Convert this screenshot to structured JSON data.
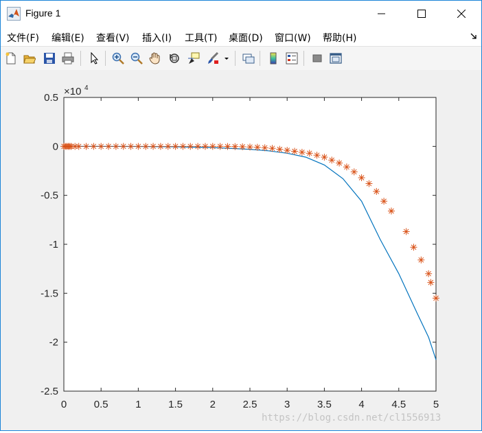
{
  "window": {
    "title": "Figure 1",
    "icon": "matlab-icon",
    "controls": [
      "minimize-icon",
      "maximize-icon",
      "close-icon"
    ]
  },
  "menu": {
    "items": [
      "文件(F)",
      "编辑(E)",
      "查看(V)",
      "插入(I)",
      "工具(T)",
      "桌面(D)",
      "窗口(W)",
      "帮助(H)"
    ],
    "overflow_icon": "dock-arrow-icon"
  },
  "toolbar": {
    "buttons": [
      "new-figure-icon",
      "open-file-icon",
      "save-icon",
      "print-icon",
      "edit-plot-icon",
      "zoom-in-icon",
      "zoom-out-icon",
      "pan-icon",
      "rotate-3d-icon",
      "data-cursor-icon",
      "brush-icon",
      "link-plot-icon",
      "insert-colorbar-icon",
      "insert-legend-icon",
      "hide-plot-tools-icon",
      "show-plot-tools-icon"
    ]
  },
  "watermark": "https://blog.csdn.net/cl1556913",
  "chart_data": {
    "type": "line",
    "exponent_label": "×10",
    "exponent_power": "4",
    "xlim": [
      0,
      5
    ],
    "ylim": [
      -2.5,
      0.5
    ],
    "xticks": [
      "0",
      "0.5",
      "1",
      "1.5",
      "2",
      "2.5",
      "3",
      "3.5",
      "4",
      "4.5",
      "5"
    ],
    "yticks": [
      "0.5",
      "0",
      "-0.5",
      "-1",
      "-1.5",
      "-2",
      "-2.5"
    ],
    "line_color": "#0072bd",
    "marker_color": "#d95319",
    "series": [
      {
        "style": "line",
        "x": [
          0,
          0.5,
          1,
          1.5,
          2,
          2.5,
          2.75,
          3,
          3.25,
          3.5,
          3.75,
          4,
          4.25,
          4.5,
          4.75,
          4.9,
          5
        ],
        "y": [
          0,
          -0.0002,
          -0.001,
          -0.004,
          -0.012,
          -0.03,
          -0.045,
          -0.07,
          -0.11,
          -0.19,
          -0.33,
          -0.56,
          -0.95,
          -1.3,
          -1.71,
          -1.95,
          -2.18
        ]
      },
      {
        "style": "marker-star",
        "x": [
          0,
          0.02,
          0.04,
          0.06,
          0.08,
          0.1,
          0.15,
          0.2,
          0.3,
          0.4,
          0.5,
          0.6,
          0.7,
          0.8,
          0.9,
          1,
          1.1,
          1.2,
          1.3,
          1.4,
          1.5,
          1.6,
          1.7,
          1.8,
          1.9,
          2,
          2.1,
          2.2,
          2.3,
          2.4,
          2.5,
          2.6,
          2.7,
          2.8,
          2.9,
          3,
          3.1,
          3.2,
          3.3,
          3.4,
          3.5,
          3.6,
          3.7,
          3.8,
          3.9,
          4,
          4.1,
          4.2,
          4.3,
          4.4,
          4.6,
          4.7,
          4.8,
          4.9,
          4.93,
          5
        ],
        "y": [
          0,
          0,
          0,
          0,
          0,
          0,
          0,
          0,
          0,
          0,
          0,
          0,
          0,
          0,
          0,
          0,
          0,
          0,
          0,
          0,
          0,
          0,
          0,
          0,
          0,
          0,
          0,
          -0.001,
          -0.002,
          -0.004,
          -0.006,
          -0.009,
          -0.014,
          -0.02,
          -0.03,
          -0.04,
          -0.05,
          -0.06,
          -0.07,
          -0.09,
          -0.11,
          -0.14,
          -0.17,
          -0.21,
          -0.26,
          -0.32,
          -0.38,
          -0.46,
          -0.56,
          -0.66,
          -0.87,
          -1.03,
          -1.16,
          -1.3,
          -1.39,
          -1.55
        ]
      }
    ]
  }
}
